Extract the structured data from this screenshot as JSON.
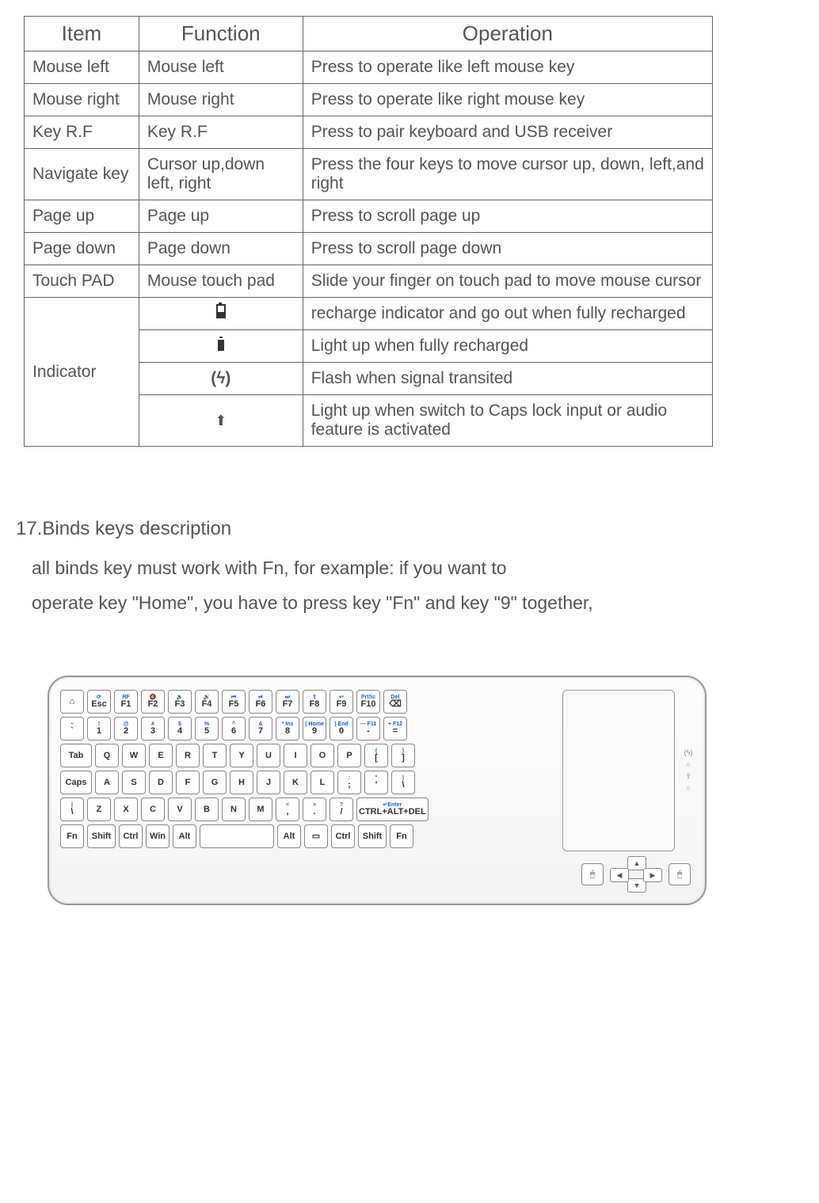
{
  "headers": {
    "item": "Item",
    "function": "Function",
    "operation": "Operation"
  },
  "rows": [
    {
      "item": "Mouse left",
      "func": "Mouse left",
      "op": "Press to operate like left mouse key"
    },
    {
      "item": "Mouse right",
      "func": "Mouse right",
      "op": "Press to operate like right mouse key"
    },
    {
      "item": "Key R.F",
      "func": "Key R.F",
      "op": "Press to pair keyboard and USB receiver"
    },
    {
      "item": "Navigate key",
      "func": "Cursor up,down left, right",
      "op": "Press the four keys to move cursor up, down, left,and right"
    },
    {
      "item": "Page up",
      "func": "Page up",
      "op": "Press to scroll page up"
    },
    {
      "item": "Page down",
      "func": "Page down",
      "op": "Press to scroll page down"
    },
    {
      "item": "Touch PAD",
      "func": "Mouse touch pad",
      "op": "Slide your finger on touch pad to move mouse cursor"
    }
  ],
  "indicator": {
    "label": "Indicator",
    "entries": [
      {
        "icon": "battery-half",
        "op": "recharge indicator and go out when fully recharged"
      },
      {
        "icon": "battery-full",
        "op": "Light up when fully recharged"
      },
      {
        "icon": "signal",
        "op": "Flash when signal transited"
      },
      {
        "icon": "arrow-up",
        "op": "Light up when switch to Caps lock input or audio feature is activated"
      }
    ]
  },
  "section": {
    "title": "17.Binds keys description",
    "body_line1": "all binds key must work with Fn, for example: if you want to",
    "body_line2": "operate key \"Home\", you have to press key \"Fn\" and key \"9\" together,"
  },
  "keyboard": {
    "row0": [
      {
        "top": "",
        "mid": "⌂"
      },
      {
        "top": "⟳",
        "mid": "Esc"
      },
      {
        "top": "RF",
        "mid": "F1"
      },
      {
        "top": "🔇",
        "mid": "F2"
      },
      {
        "top": "🔉",
        "mid": "F3"
      },
      {
        "top": "🔊",
        "mid": "F4"
      },
      {
        "top": "⏮",
        "mid": "F5"
      },
      {
        "top": "⏯",
        "mid": "F6"
      },
      {
        "top": "⏭",
        "mid": "F7"
      },
      {
        "top": "⇧",
        "mid": "F8"
      },
      {
        "top": "↩",
        "mid": "F9"
      },
      {
        "top": "PrtSc",
        "mid": "F10"
      },
      {
        "top": "Del",
        "mid": "⌫"
      }
    ],
    "row1": [
      {
        "top": "~",
        "mid": "`"
      },
      {
        "top": "!",
        "mid": "1"
      },
      {
        "top": "@",
        "mid": "2"
      },
      {
        "top": "#",
        "mid": "3"
      },
      {
        "top": "$",
        "mid": "4"
      },
      {
        "top": "%",
        "mid": "5"
      },
      {
        "top": "^",
        "mid": "6"
      },
      {
        "top": "&",
        "mid": "7"
      },
      {
        "top": "* Ins",
        "mid": "8"
      },
      {
        "top": "( Home",
        "mid": "9"
      },
      {
        "top": ") End",
        "mid": "0"
      },
      {
        "top": "— F11",
        "mid": "-"
      },
      {
        "top": "+ F12",
        "mid": "="
      }
    ],
    "row2": [
      {
        "mid": "Tab",
        "cls": "wide-tab"
      },
      {
        "mid": "Q"
      },
      {
        "mid": "W"
      },
      {
        "mid": "E"
      },
      {
        "mid": "R"
      },
      {
        "mid": "T"
      },
      {
        "mid": "Y"
      },
      {
        "mid": "U"
      },
      {
        "mid": "I"
      },
      {
        "mid": "O"
      },
      {
        "mid": "P"
      },
      {
        "top": "{",
        "mid": "["
      },
      {
        "top": "}",
        "mid": "]"
      }
    ],
    "row3": [
      {
        "mid": "Caps",
        "cls": "wide-caps"
      },
      {
        "mid": "A"
      },
      {
        "mid": "S"
      },
      {
        "mid": "D"
      },
      {
        "mid": "F"
      },
      {
        "mid": "G"
      },
      {
        "mid": "H"
      },
      {
        "mid": "J"
      },
      {
        "mid": "K"
      },
      {
        "mid": "L"
      },
      {
        "top": ":",
        "mid": ";"
      },
      {
        "top": "\"",
        "mid": "'"
      },
      {
        "top": "|",
        "mid": "\\"
      }
    ],
    "row4": [
      {
        "top": "|",
        "mid": "\\"
      },
      {
        "mid": "Z"
      },
      {
        "mid": "X"
      },
      {
        "mid": "C"
      },
      {
        "mid": "V"
      },
      {
        "mid": "B"
      },
      {
        "mid": "N"
      },
      {
        "mid": "M"
      },
      {
        "top": "<",
        "mid": ","
      },
      {
        "top": ">",
        "mid": "."
      },
      {
        "top": "?",
        "mid": "/"
      },
      {
        "top": "↵Enter",
        "mid": "CTRL+ALT+DEL",
        "cls": "wide-enter"
      }
    ],
    "row5": [
      {
        "mid": "Fn",
        "cls": "fn"
      },
      {
        "mid": "Shift",
        "cls": "wide-shift"
      },
      {
        "mid": "Ctrl"
      },
      {
        "mid": "Win"
      },
      {
        "mid": "Alt"
      },
      {
        "mid": "",
        "cls": "wide-space"
      },
      {
        "mid": "Alt"
      },
      {
        "mid": "▭"
      },
      {
        "mid": "Ctrl"
      },
      {
        "mid": "Shift",
        "cls": "wide-shift"
      },
      {
        "mid": "Fn",
        "cls": "fn"
      }
    ],
    "indicators": [
      "(ϟ)",
      "○",
      "⇧",
      "○"
    ],
    "dpad": {
      "up": "▲",
      "down": "▼",
      "left": "◀",
      "right": "▶"
    },
    "mouse_left": "🖱",
    "mouse_right": "🖱"
  }
}
